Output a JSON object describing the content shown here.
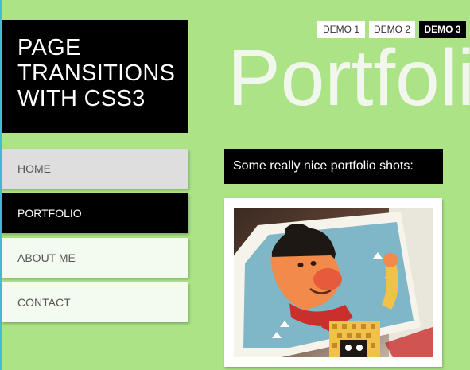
{
  "site": {
    "title_lines": [
      "PAGE",
      "TRANSITIONS",
      "WITH CSS3"
    ]
  },
  "nav": {
    "items": [
      {
        "label": "HOME"
      },
      {
        "label": "PORTFOLIO"
      },
      {
        "label": "ABOUT ME"
      },
      {
        "label": "CONTACT"
      }
    ]
  },
  "demos": {
    "items": [
      {
        "label": "DEMO 1"
      },
      {
        "label": "DEMO 2"
      },
      {
        "label": "DEMO 3"
      }
    ]
  },
  "main": {
    "heading": "Portfolio",
    "caption": "Some really nice portfolio shots:"
  },
  "colors": {
    "background": "#abe386",
    "dark": "#000000",
    "nav_light": "#f3fbef",
    "nav_active_home": "#dedede",
    "heading": "#f2f7ee"
  }
}
